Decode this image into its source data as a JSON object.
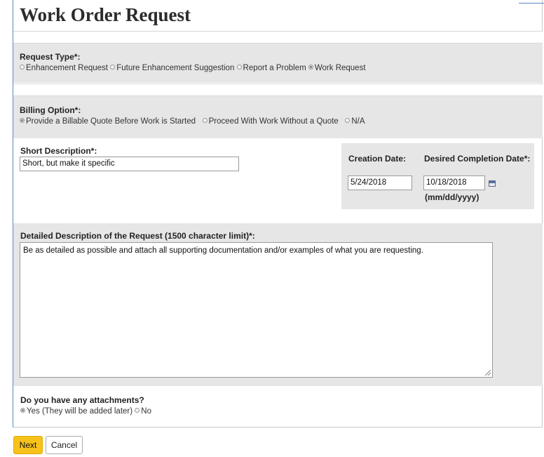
{
  "page": {
    "title": "Work Order Request"
  },
  "request_type": {
    "label": "Request Type*:",
    "options": [
      {
        "label": "Enhancement Request",
        "selected": false
      },
      {
        "label": "Future Enhancement Suggestion",
        "selected": false
      },
      {
        "label": "Report a Problem",
        "selected": false
      },
      {
        "label": "Work Request",
        "selected": true
      }
    ]
  },
  "billing_option": {
    "label": "Billing Option*:",
    "options": [
      {
        "label": "Provide a Billable Quote Before Work is Started",
        "selected": true
      },
      {
        "label": "Proceed With Work Without a Quote",
        "selected": false
      },
      {
        "label": "N/A",
        "selected": false
      }
    ]
  },
  "short_description": {
    "label": "Short Description*:",
    "value": "Short, but make it specific"
  },
  "creation_date": {
    "label": "Creation Date:",
    "value": "5/24/2018"
  },
  "desired_completion_date": {
    "label": "Desired Completion Date*:",
    "value": "10/18/2018",
    "hint": "(mm/dd/yyyy)"
  },
  "detailed_description": {
    "label": "Detailed Description of the Request (1500 character limit)*:",
    "value": "Be as detailed as possible and attach all supporting documentation and/or examples of what you are requesting."
  },
  "attachments": {
    "label": "Do you have any attachments?",
    "options": [
      {
        "label": "Yes (They will be added later)",
        "selected": true
      },
      {
        "label": "No",
        "selected": false
      }
    ]
  },
  "buttons": {
    "next": "Next",
    "cancel": "Cancel"
  },
  "colors": {
    "primary_button": "#f7c21b",
    "section_gray": "#e6e6e6",
    "frame_blue": "#5b87c5"
  }
}
